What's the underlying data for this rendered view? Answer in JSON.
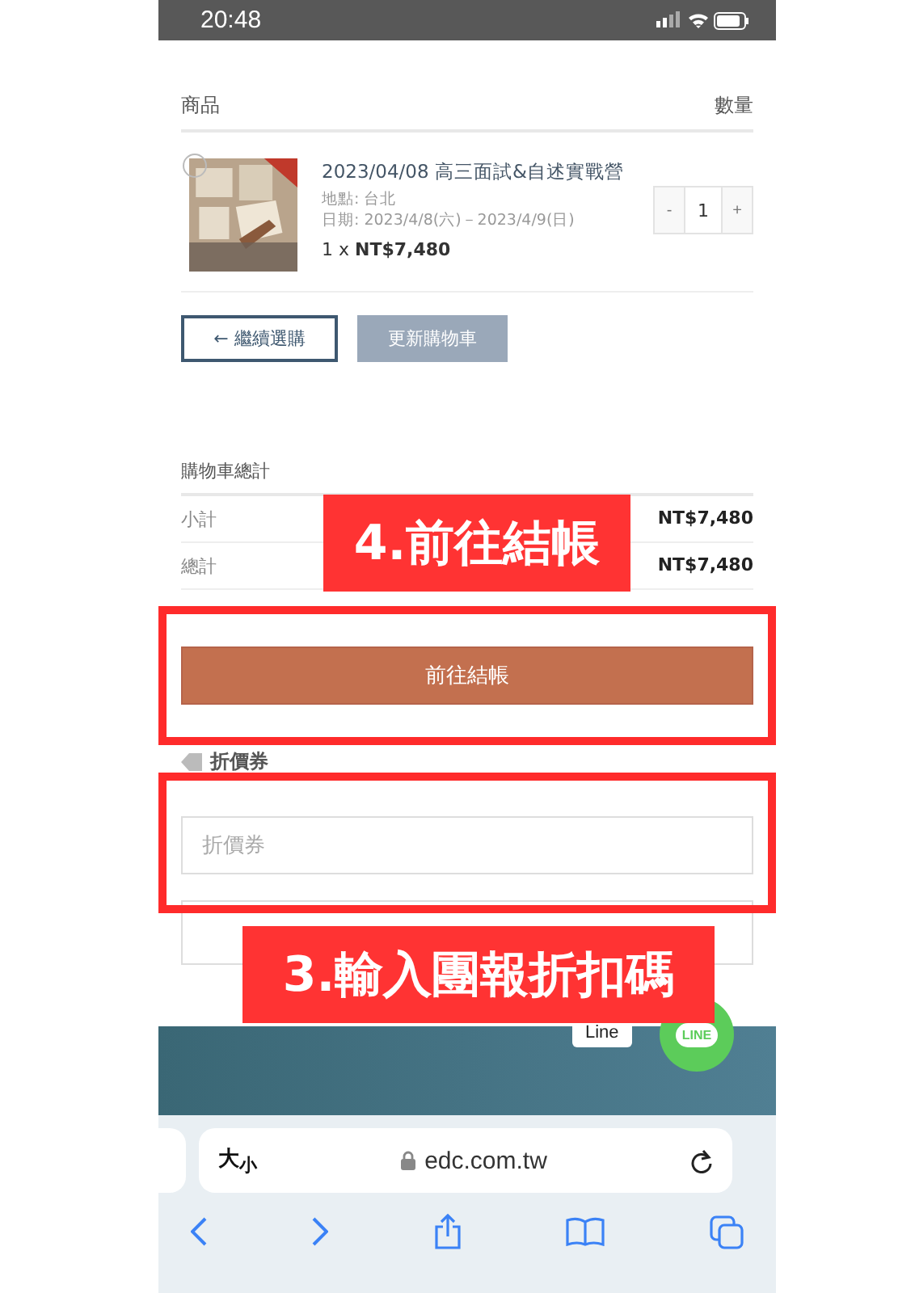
{
  "status_bar": {
    "time": "20:48"
  },
  "cart": {
    "columns": [
      "商品",
      "數量"
    ],
    "items": [
      {
        "kind": "picture",
        "title": "2023/04/08 高三面試&自述實戰營",
        "location": "地點: 台北",
        "dates": "日期: 2023/4/8(六)－2023/4/9(日)",
        "price_line": "1 x **NT$7,480**",
        "minus": "-",
        "quantity": "1",
        "plus": "+"
      }
    ]
  },
  "continue_button": "← 繼續選購",
  "update_button": "更新購物車",
  "totals": {
    "title": "購物車總計",
    "rows": [
      {
        "label": "小計",
        "value": "NT$7,480"
      },
      {
        "label": "總計",
        "value": "NT$7,480"
      }
    ]
  },
  "checkout_button": "前往結帳",
  "coupon": {
    "title": "折價券",
    "placeholder": "折價券"
  },
  "chat": {
    "bubble": "Line",
    "button": "LINE"
  },
  "browser": {
    "text_size": "大$_{小}$",
    "url": "edc.com.tw"
  },
  "annotations": [
    {
      "label": "4.前往結帳"
    },
    {
      "label": "3.輸入團報折扣碼"
    }
  ]
}
